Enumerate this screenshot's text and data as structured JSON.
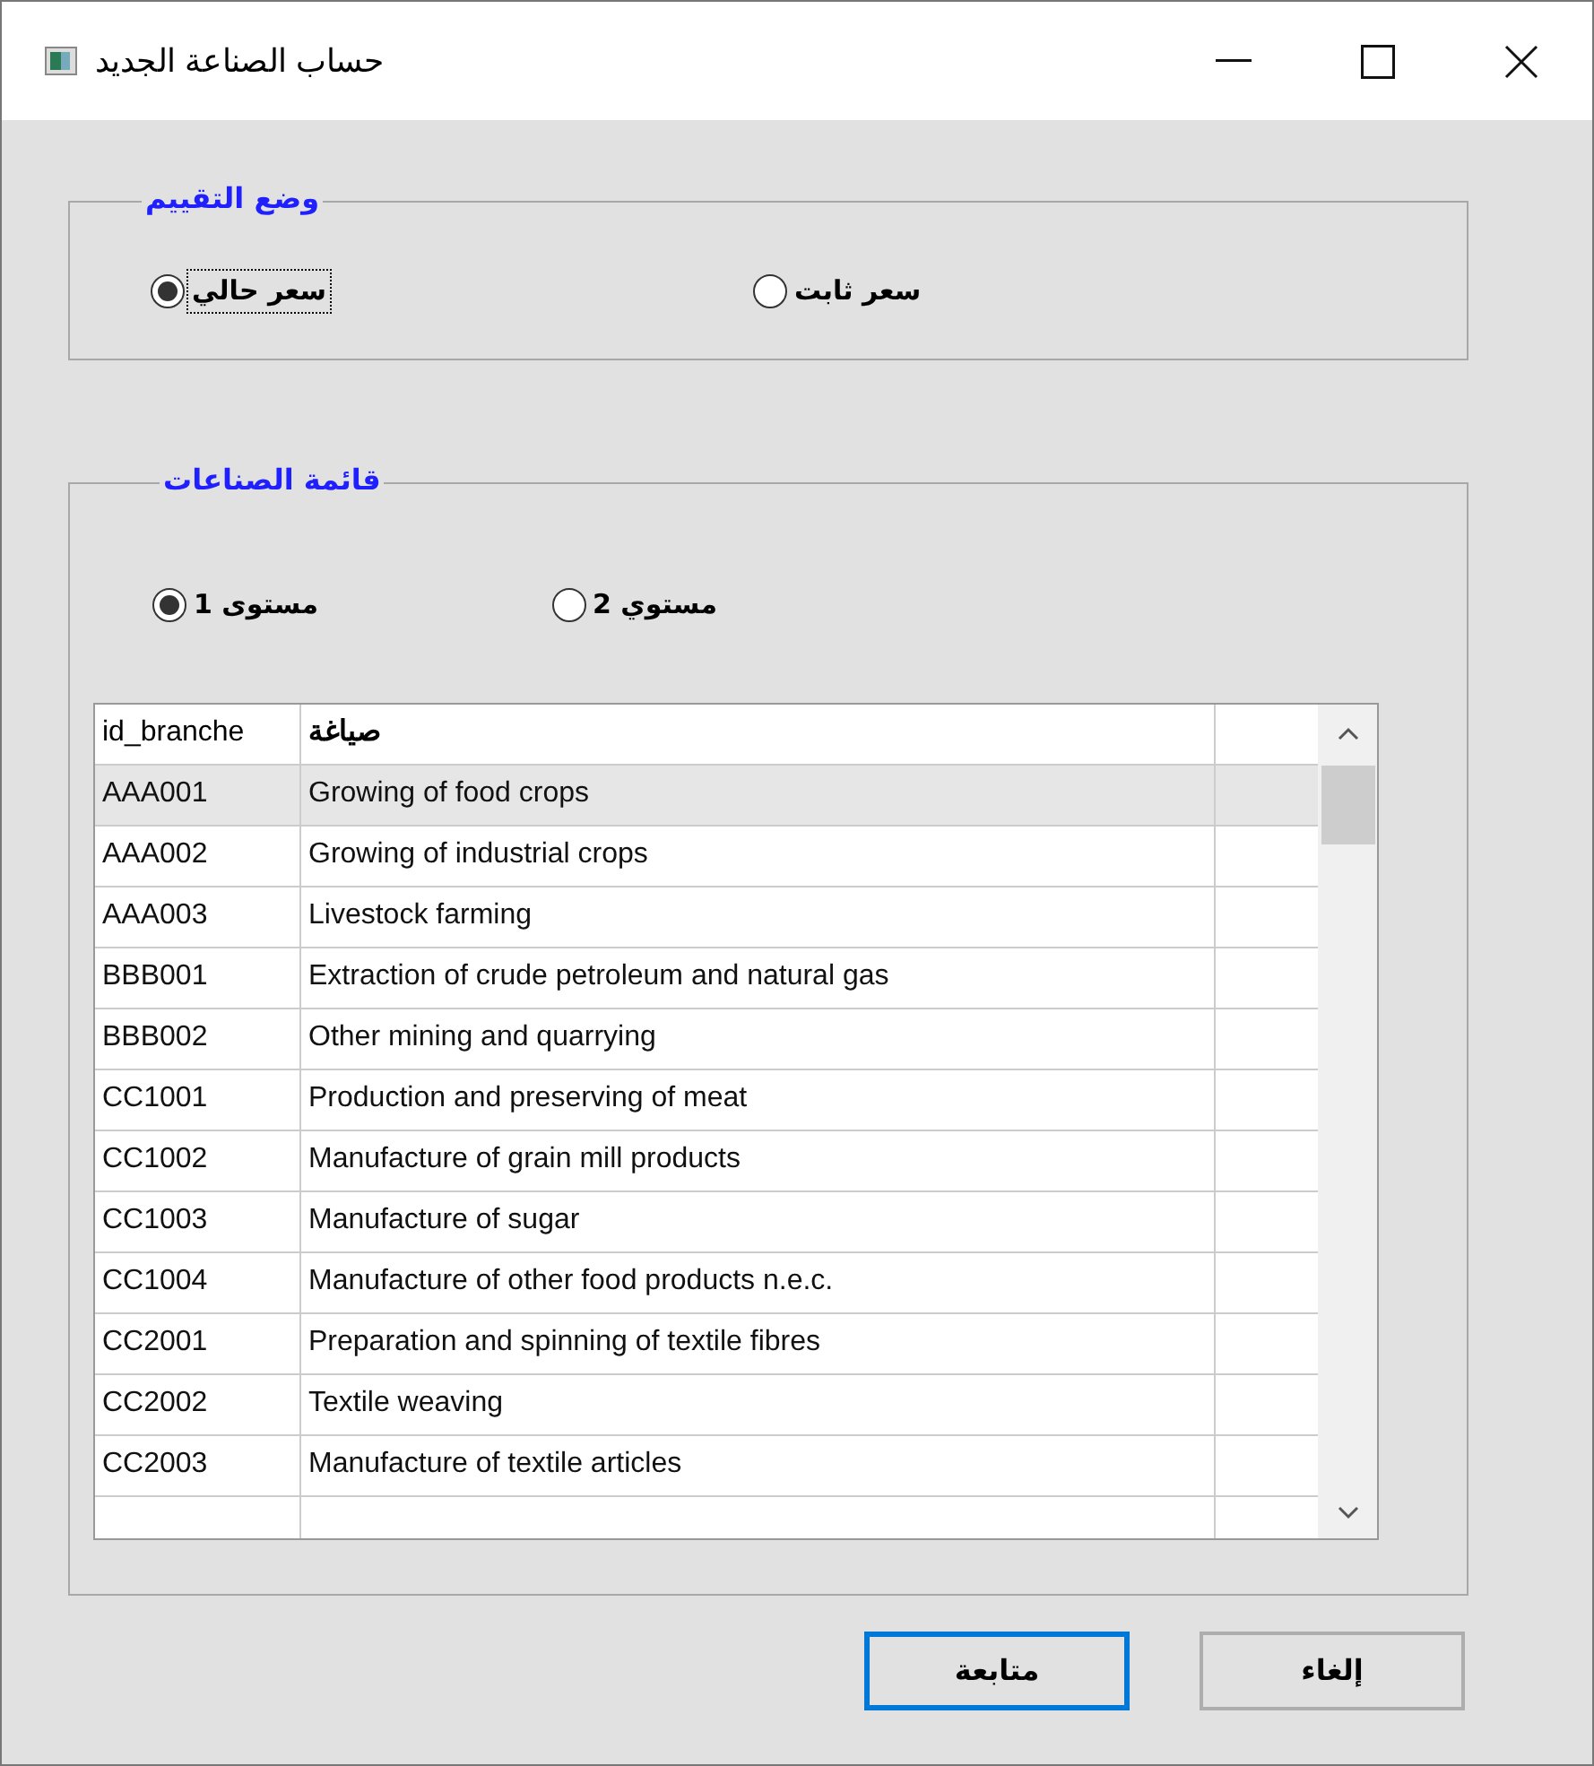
{
  "window": {
    "title": "حساب الصناعة الجديد"
  },
  "pricing": {
    "legend": "وضع التقييم",
    "options": [
      {
        "label": "سعر ثابت",
        "selected": false,
        "focused": false
      },
      {
        "label": "سعر حالي",
        "selected": true,
        "focused": true
      }
    ]
  },
  "industries": {
    "legend": "قائمة الصناعات",
    "levels": [
      {
        "label": "مستوي 2",
        "selected": false
      },
      {
        "label": "مستوى 1",
        "selected": true
      }
    ],
    "table": {
      "columns": [
        "id_branche",
        "صياغة"
      ],
      "rows": [
        {
          "cells": [
            "AAA001",
            "Growing of food crops"
          ],
          "selected": true
        },
        {
          "cells": [
            "AAA002",
            "Growing of industrial crops"
          ],
          "selected": false
        },
        {
          "cells": [
            "AAA003",
            "Livestock farming"
          ],
          "selected": false
        },
        {
          "cells": [
            "BBB001",
            "Extraction of crude petroleum and natural gas"
          ],
          "selected": false
        },
        {
          "cells": [
            "BBB002",
            "Other mining and quarrying"
          ],
          "selected": false
        },
        {
          "cells": [
            "CC1001",
            "Production and preserving of meat"
          ],
          "selected": false
        },
        {
          "cells": [
            "CC1002",
            "Manufacture of grain mill products"
          ],
          "selected": false
        },
        {
          "cells": [
            "CC1003",
            "Manufacture of sugar"
          ],
          "selected": false
        },
        {
          "cells": [
            "CC1004",
            "Manufacture of other food products n.e.c."
          ],
          "selected": false
        },
        {
          "cells": [
            "CC2001",
            "Preparation and spinning of textile fibres"
          ],
          "selected": false
        },
        {
          "cells": [
            "CC2002",
            "Textile weaving"
          ],
          "selected": false
        },
        {
          "cells": [
            "CC2003",
            "Manufacture of textile articles"
          ],
          "selected": false
        }
      ]
    }
  },
  "buttons": [
    {
      "label": "إلغاء",
      "default": false
    },
    {
      "label": "متابعة",
      "default": true
    }
  ]
}
